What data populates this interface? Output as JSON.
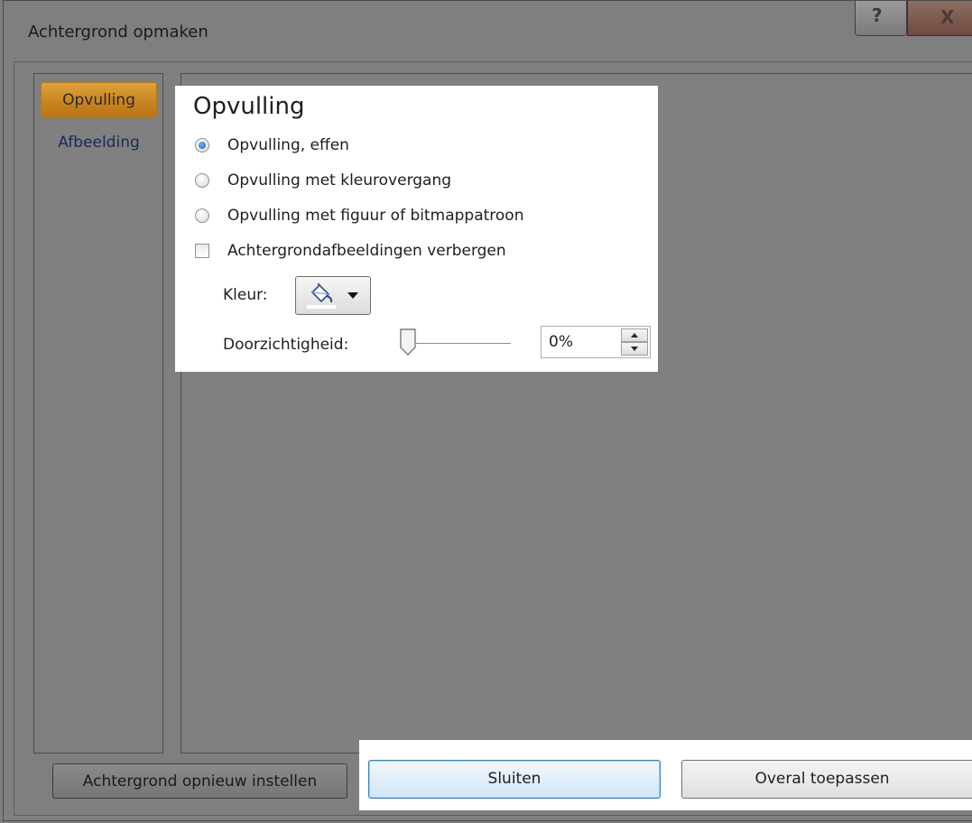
{
  "window": {
    "title": "Achtergrond opmaken",
    "help_glyph": "?",
    "close_glyph": "X"
  },
  "nav": {
    "items": [
      {
        "label": "Opvulling",
        "active": true
      },
      {
        "label": "Afbeelding",
        "active": false
      }
    ]
  },
  "fill": {
    "section_title": "Opvulling",
    "options": [
      {
        "label": "Opvulling, effen",
        "selected": true
      },
      {
        "label": "Opvulling met kleurovergang",
        "selected": false
      },
      {
        "label": "Opvulling met figuur of bitmappatroon",
        "selected": false
      }
    ],
    "hide_background_graphics": {
      "label": "Achtergrondafbeeldingen verbergen",
      "checked": false
    },
    "color": {
      "label": "Kleur:",
      "icon": "paint-bucket-icon",
      "swatch": "#ffffff"
    },
    "transparency": {
      "label": "Doorzichtigheid:",
      "value": "0%",
      "level": 0
    }
  },
  "buttons": {
    "reset": "Achtergrond opnieuw instellen",
    "close": "Sluiten",
    "apply_all": "Overal toepassen"
  },
  "colors": {
    "dim_overlay": "#808080",
    "active_nav": "#d8952c",
    "default_button_border": "#3c7fb1"
  }
}
